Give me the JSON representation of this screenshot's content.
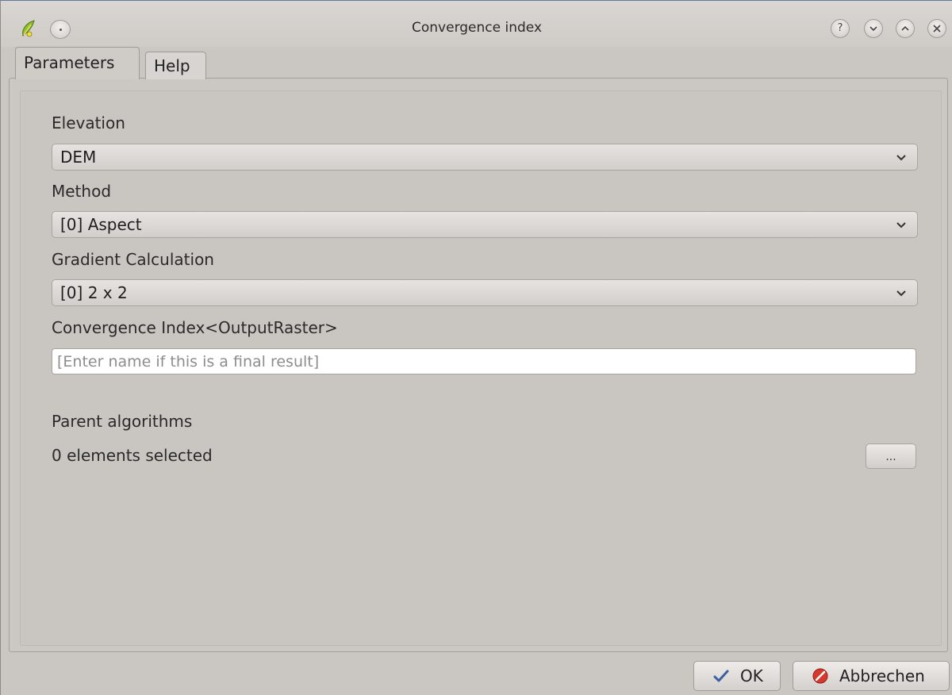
{
  "window": {
    "title": "Convergence index"
  },
  "titlebar_buttons": {
    "help": "?",
    "minimize": "⌄",
    "maximize": "⌃",
    "close": "×"
  },
  "tabs": [
    {
      "label": "Parameters",
      "active": true
    },
    {
      "label": "Help",
      "active": false
    }
  ],
  "form": {
    "elevation": {
      "label": "Elevation",
      "value": "DEM"
    },
    "method": {
      "label": "Method",
      "value": "[0] Aspect"
    },
    "gradient": {
      "label": "Gradient Calculation",
      "value": "[0] 2 x 2"
    },
    "output": {
      "label": "Convergence Index<OutputRaster>",
      "value": "",
      "placeholder": "[Enter name if this is a final result]"
    },
    "parent": {
      "label": "Parent algorithms",
      "status": "0 elements selected",
      "button_label": "..."
    }
  },
  "buttons": {
    "ok": "OK",
    "cancel": "Abbrechen"
  },
  "colors": {
    "ok_check": "#3c5f9e",
    "cancel_red": "#d63a2f",
    "app_icon_green": "#8fbf2a"
  }
}
